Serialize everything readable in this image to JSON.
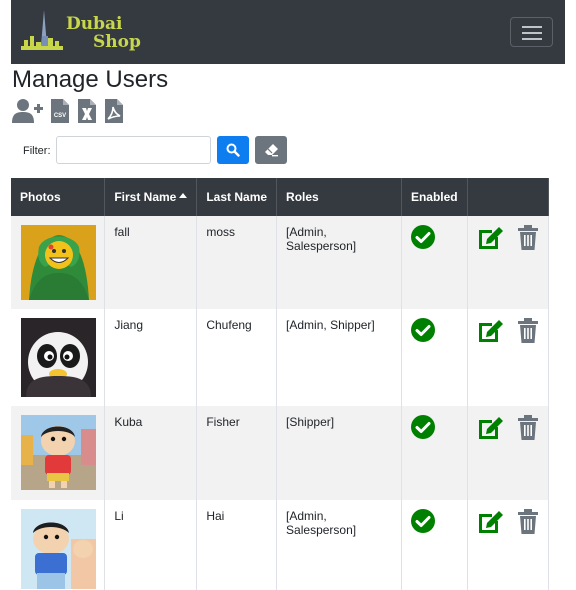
{
  "brand": {
    "line1": "Dubai",
    "line2": "Shop"
  },
  "page": {
    "title": "Manage Users"
  },
  "toolbar": {
    "icons": [
      "add-user-icon",
      "csv-file-icon",
      "excel-file-icon",
      "pdf-file-icon"
    ],
    "csv_label": "CSV"
  },
  "filter": {
    "label": "Filter:",
    "value": "",
    "placeholder": ""
  },
  "table": {
    "headers": {
      "photos": "Photos",
      "first_name": "First Name",
      "last_name": "Last Name",
      "roles": "Roles",
      "enabled": "Enabled",
      "actions": ""
    },
    "sort": {
      "column": "First Name",
      "direction": "ascending"
    },
    "rows": [
      {
        "first_name": "fall",
        "last_name": "moss",
        "roles": "[Admin, Salesperson]",
        "enabled": true
      },
      {
        "first_name": "Jiang",
        "last_name": "Chufeng",
        "roles": "[Admin, Shipper]",
        "enabled": true
      },
      {
        "first_name": "Kuba",
        "last_name": "Fisher",
        "roles": "[Shipper]",
        "enabled": true
      },
      {
        "first_name": "Li",
        "last_name": "Hai",
        "roles": "[Admin, Salesperson]",
        "enabled": true
      }
    ]
  },
  "colors": {
    "navbar": "#343a40",
    "brand_text": "#c8d64a",
    "primary": "#0d7df0",
    "secondary": "#6c757d",
    "success": "#008000",
    "trash": "#6c757d"
  }
}
